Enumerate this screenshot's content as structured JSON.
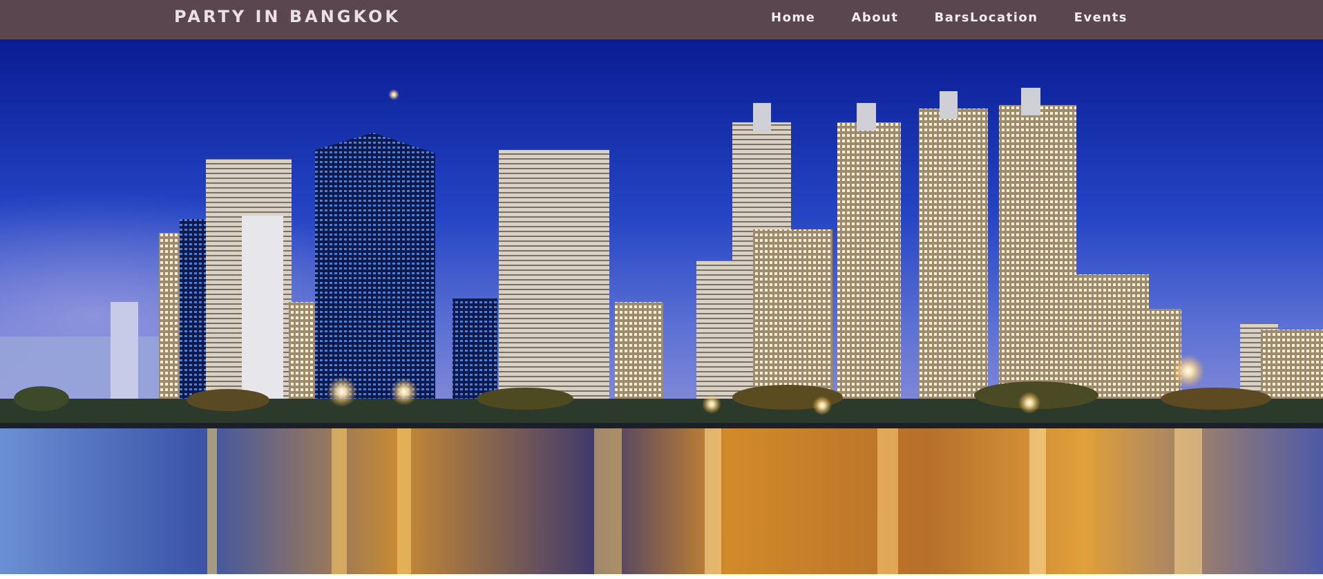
{
  "navbar": {
    "brand": "PARTY IN BANGKOK",
    "links": [
      {
        "label": "Home"
      },
      {
        "label": "About"
      },
      {
        "label": "BarsLocation"
      },
      {
        "label": "Events"
      }
    ]
  },
  "colors": {
    "navbar_bg": "#5a464e",
    "nav_text": "#f1ecef",
    "sky_top": "#0b1f9a",
    "sky_bottom": "#4a63d6",
    "water_warm": "#e79a2c"
  }
}
